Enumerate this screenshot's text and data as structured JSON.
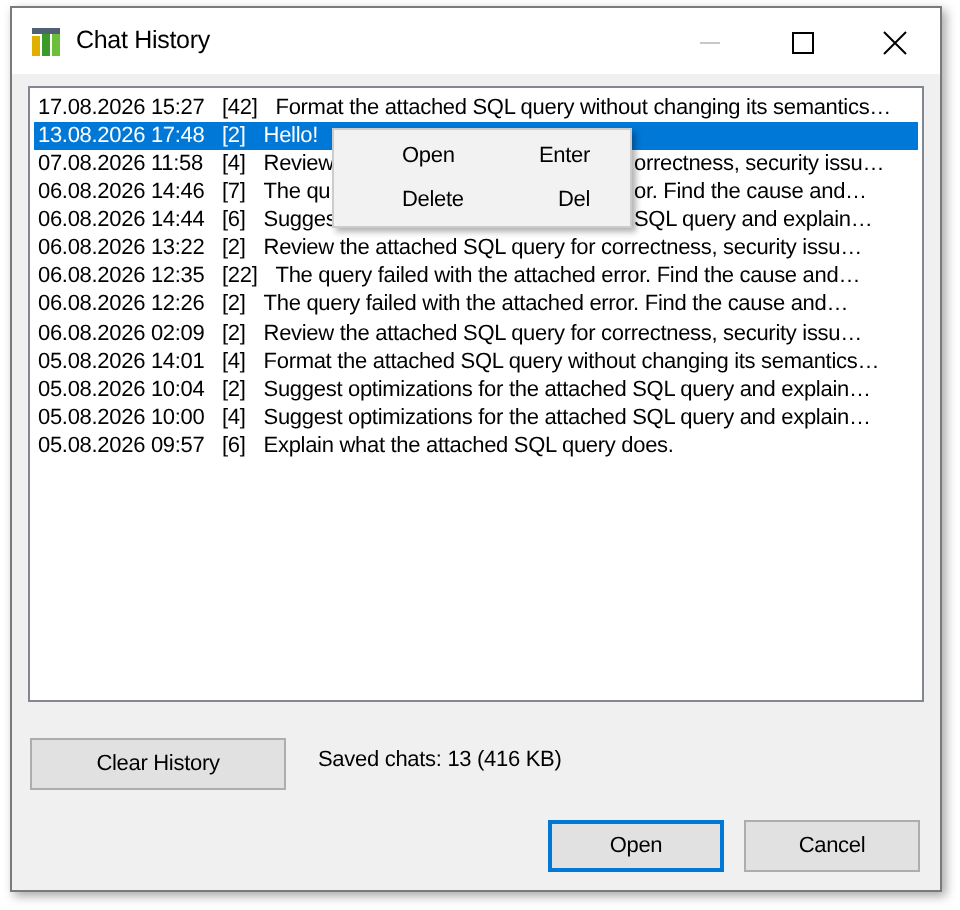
{
  "window": {
    "title": "Chat History",
    "minimize_disabled": true
  },
  "chats": [
    {
      "date": "17.08.2026 15:27",
      "count": "[42]",
      "message": [
        "Format the attached SQL query without changing its semantics…"
      ],
      "selected": false
    },
    {
      "date": "13.08.2026 17:48",
      "count": "[2]",
      "message": [
        "Hello!"
      ],
      "selected": true
    },
    {
      "date": "07.08.2026 11:58",
      "count": "[4]",
      "message": [
        "Review",
        "orrectness, security issu…"
      ],
      "selected": false
    },
    {
      "date": "06.08.2026 14:46",
      "count": "[7]",
      "message": [
        "The qu",
        "or. Find the cause and…"
      ],
      "selected": false
    },
    {
      "date": "06.08.2026 14:44",
      "count": "[6]",
      "message": [
        "Sugges",
        "SQL query and explain…"
      ],
      "selected": false
    },
    {
      "date": "06.08.2026 13:22",
      "count": "[2]",
      "message": [
        "Review the attached SQL query for correctness, security issu…"
      ],
      "selected": false
    },
    {
      "date": "06.08.2026 12:35",
      "count": "[22]",
      "message": [
        "The query failed with the attached error. Find the cause and…"
      ],
      "selected": false
    },
    {
      "date": "06.08.2026 12:26",
      "count": "[2]",
      "message": [
        "The query failed with the attached error. Find the cause and…"
      ],
      "selected": false
    },
    {
      "date": "06.08.2026 02:09",
      "count": "[2]",
      "message": [
        "Review the attached SQL query for correctness, security issu…"
      ],
      "selected": false
    },
    {
      "date": "05.08.2026 14:01",
      "count": "[4]",
      "message": [
        "Format the attached SQL query without changing its semantics…"
      ],
      "selected": false
    },
    {
      "date": "05.08.2026 10:04",
      "count": "[2]",
      "message": [
        "Suggest optimizations for the attached SQL query and explain…"
      ],
      "selected": false
    },
    {
      "date": "05.08.2026 10:00",
      "count": "[4]",
      "message": [
        "Suggest optimizations for the attached SQL query and explain…"
      ],
      "selected": false
    },
    {
      "date": "05.08.2026 09:57",
      "count": "[6]",
      "message": [
        "Explain what the attached SQL query does."
      ],
      "selected": false
    }
  ],
  "context_menu": [
    {
      "label": "Open",
      "shortcut": "Enter"
    },
    {
      "label": "Delete",
      "shortcut": "Del"
    }
  ],
  "clear_button": "Clear History",
  "status": "Saved chats: 13 (416 KB)",
  "buttons": [
    {
      "label": "Open",
      "default": true
    },
    {
      "label": "Cancel",
      "default": false
    }
  ]
}
